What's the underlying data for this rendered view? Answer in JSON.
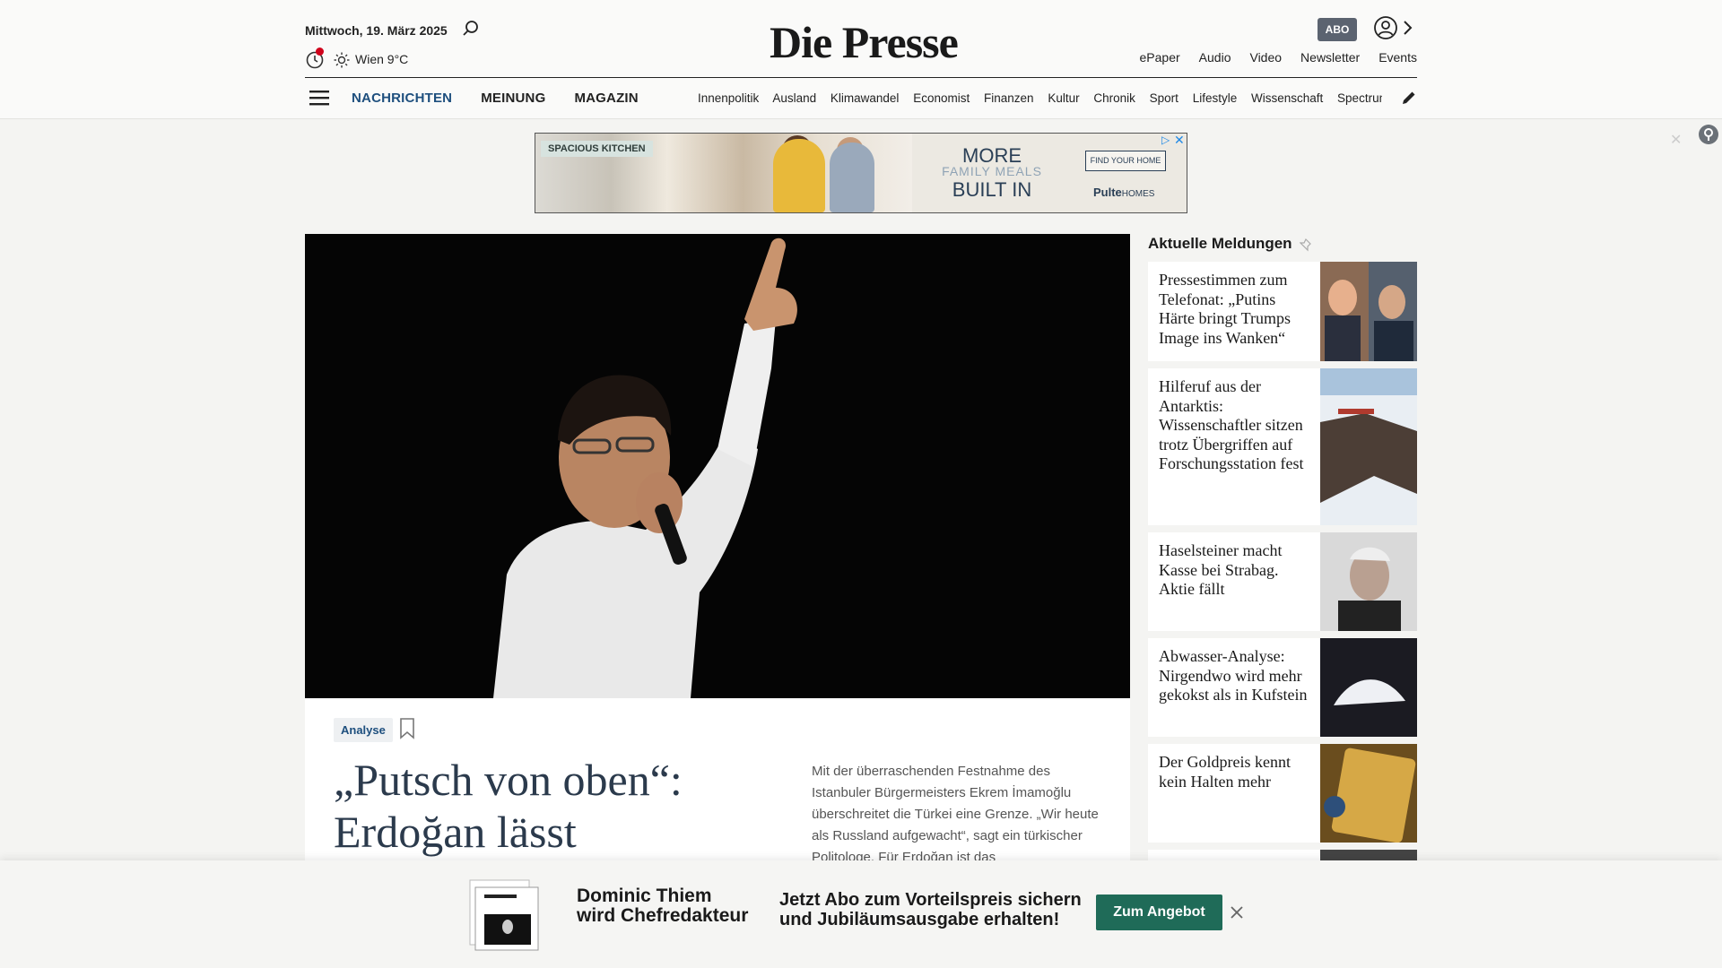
{
  "header": {
    "date": "Mittwoch, 19. März 2025",
    "weather": "Wien 9°C",
    "logo": "Die Presse",
    "abo_label": "ABO",
    "top_links": [
      "ePaper",
      "Audio",
      "Video",
      "Newsletter",
      "Events"
    ],
    "main_nav": [
      "NACHRICHTEN",
      "MEINUNG",
      "MAGAZIN"
    ],
    "sub_nav": [
      "Innenpolitik",
      "Ausland",
      "Klimawandel",
      "Economist",
      "Finanzen",
      "Kultur",
      "Chronik",
      "Sport",
      "Lifestyle",
      "Wissenschaft",
      "Spectrum"
    ]
  },
  "ad": {
    "tag": "SPACIOUS KITCHEN",
    "line1": "MORE",
    "line2": "FAMILY MEALS",
    "line3": "BUILT IN",
    "cta": "FIND YOUR HOME",
    "brand": "Pulte",
    "brand_suffix": "HOMES"
  },
  "hero": {
    "tag": "Analyse",
    "headline": "„Putsch von oben“: Erdoğan lässt",
    "teaser": "Mit der überraschenden Festnahme des Istanbuler Bürgermeisters Ekrem İmamoğlu überschreitet die Türkei eine Grenze. „Wir heute als Russland aufgewacht“, sagt ein türkischer Politologe. Für Erdoğan ist das"
  },
  "sidebar": {
    "title": "Aktuelle Meldungen",
    "items": [
      {
        "title": "Pressestimmen zum Telefonat: „Putins Härte bringt Trumps Image ins Wanken“",
        "thumb": "politicians-phone"
      },
      {
        "title": "Hilferuf aus der Antarktis: Wissenschaftler sitzen trotz Übergriffen auf Forschungsstation fest",
        "thumb": "antarctica-aerial"
      },
      {
        "title": "Haselsteiner macht Kasse bei Strabag. Aktie fällt",
        "thumb": "portrait-man"
      },
      {
        "title": "Abwasser-Analyse: Nirgendwo wird mehr gekokst als in Kufstein",
        "thumb": "white-powder"
      },
      {
        "title": "Der Goldpreis kennt kein Halten mehr",
        "thumb": "gold-bar"
      }
    ]
  },
  "promo": {
    "line1": "Dominic Thiem",
    "line2": "wird Chefredakteur",
    "offer1": "Jetzt Abo zum Vorteilspreis sichern",
    "offer2": "und Jubiläumsausgabe erhalten!",
    "button": "Zum Angebot"
  },
  "colors": {
    "nav_active": "#1e4f7e",
    "promo_button": "#1f6b58",
    "abo_badge": "#5b6370",
    "notification_dot": "#d0021b"
  }
}
